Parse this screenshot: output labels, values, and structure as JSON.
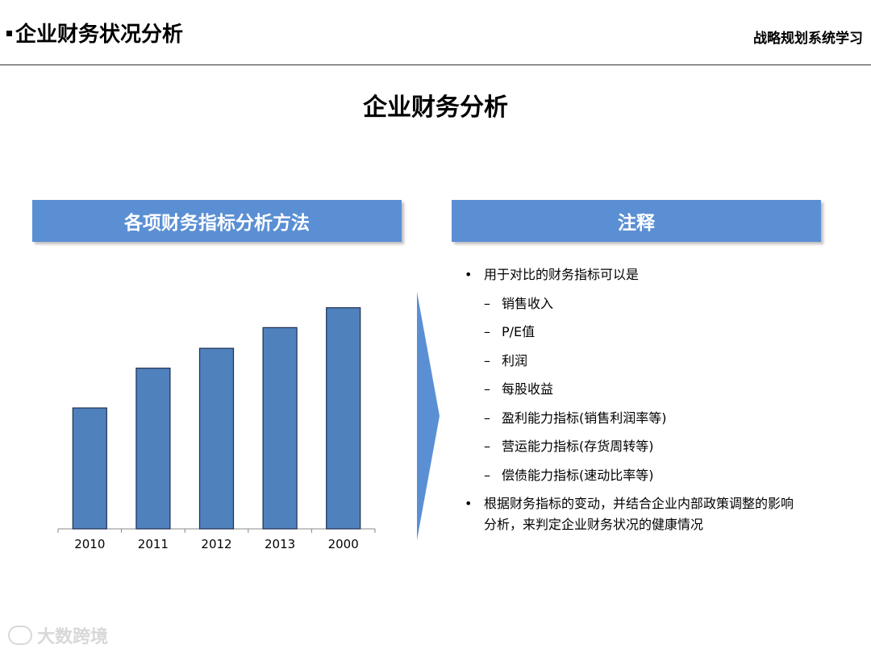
{
  "header": {
    "title": "企业财务状况分析",
    "right_label": "战略规划系统学习"
  },
  "page_title": "企业财务分析",
  "left_panel": {
    "title": "各项财务指标分析方法"
  },
  "right_panel": {
    "title": "注释",
    "bullet_mark": "•",
    "dash_mark": "–",
    "intro": "用于对比的财务指标可以是",
    "items": [
      "销售收入",
      "P/E值",
      "利润",
      "每股收益",
      "盈利能力指标(销售利润率等)",
      "营运能力指标(存货周转等)",
      "偿债能力指标(速动比率等)"
    ],
    "conclusion_line1": "根据财务指标的变动，并结合企业内部政策调整的影响",
    "conclusion_line2": "分析，来判定企业财务状况的健康情况"
  },
  "chart_data": {
    "type": "bar",
    "categories": [
      "2010",
      "2011",
      "2012",
      "2013",
      "2000"
    ],
    "values": [
      152,
      202,
      227,
      253,
      278
    ],
    "ylim": [
      0,
      300
    ],
    "grid": false,
    "bar_color": "#4f81bd"
  },
  "watermark": {
    "text": "大数跨境"
  },
  "colors": {
    "panel_header": "#5b8fd4",
    "arrow": "#5b8fd4"
  }
}
